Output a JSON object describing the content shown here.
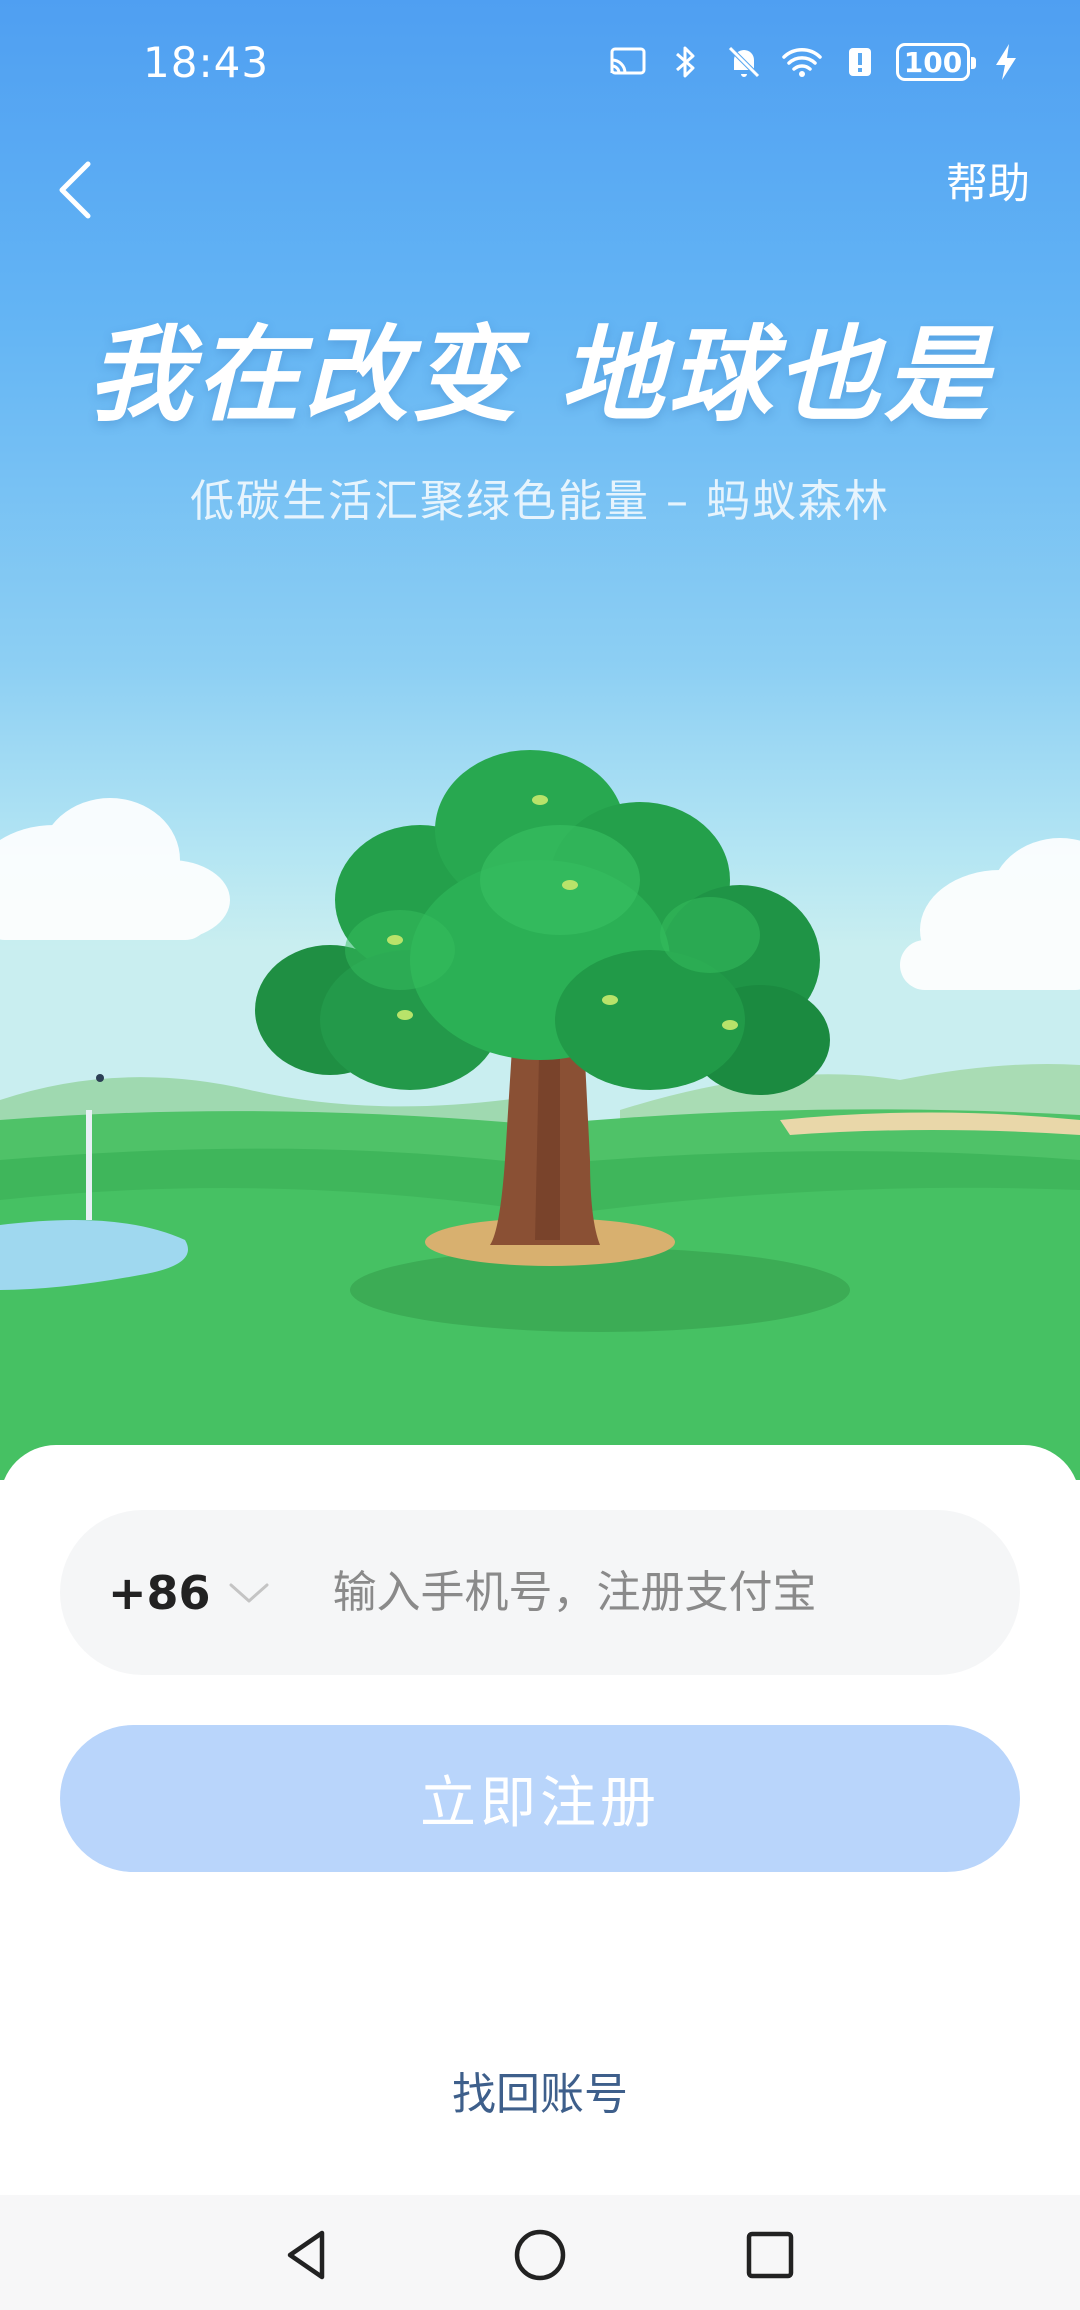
{
  "status_bar": {
    "time": "18:43",
    "battery": "100",
    "icons": [
      "cast-icon",
      "bluetooth-icon",
      "mute-notification-icon",
      "wifi-icon",
      "alert-icon",
      "battery-icon",
      "charging-icon"
    ]
  },
  "header": {
    "back_icon": "chevron-left-icon",
    "help_label": "帮助"
  },
  "hero": {
    "headline": "我在改变 地球也是",
    "subline": "低碳生活汇聚绿色能量 – 蚂蚁森林"
  },
  "form": {
    "country_code": "+86",
    "phone_placeholder": "输入手机号，注册支付宝",
    "register_label": "立即注册"
  },
  "footer": {
    "recover_label": "找回账号"
  },
  "nav": [
    "back-triangle-icon",
    "home-circle-icon",
    "recents-square-icon"
  ],
  "colors": {
    "register_button": "#b9d5fb",
    "link": "#3e5f8b",
    "field_bg": "#f5f6f7"
  }
}
